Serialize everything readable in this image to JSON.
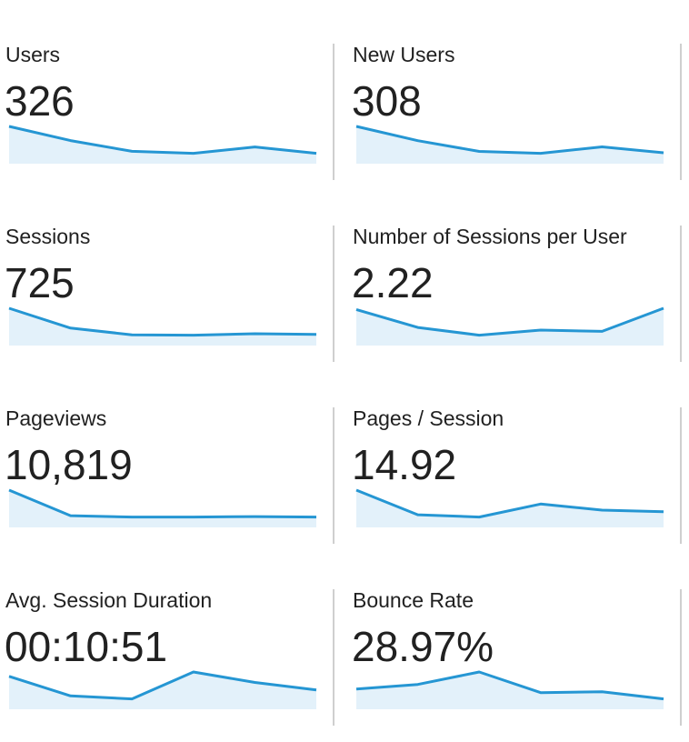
{
  "colors": {
    "line": "#2596d3",
    "fill": "#e3f1fa",
    "divider": "#cfcfcf",
    "text": "#212121"
  },
  "chart_data": [
    {
      "type": "area",
      "title": "Users",
      "value": "326",
      "values": [
        326,
        270,
        228,
        220,
        245,
        220
      ]
    },
    {
      "type": "area",
      "title": "New Users",
      "value": "308",
      "values": [
        308,
        255,
        215,
        208,
        232,
        210
      ]
    },
    {
      "type": "area",
      "title": "Sessions",
      "value": "725",
      "values": [
        725,
        460,
        370,
        365,
        385,
        375
      ]
    },
    {
      "type": "area",
      "title": "Number of Sessions per User",
      "value": "2.22",
      "values": [
        2.22,
        2.08,
        2.02,
        2.06,
        2.05,
        2.23
      ]
    },
    {
      "type": "area",
      "title": "Pageviews",
      "value": "10,819",
      "values": [
        10819,
        5000,
        4700,
        4700,
        4800,
        4700
      ]
    },
    {
      "type": "area",
      "title": "Pages / Session",
      "value": "14.92",
      "values": [
        14.92,
        11.7,
        11.4,
        13.1,
        12.3,
        12.1
      ]
    },
    {
      "type": "area",
      "title": "Avg. Session Duration",
      "value": "00:10:51",
      "values": [
        651,
        520,
        500,
        680,
        610,
        560
      ]
    },
    {
      "type": "area",
      "title": "Bounce Rate",
      "value": "28.97%",
      "values": [
        27.3,
        28.7,
        32.5,
        26.2,
        26.5,
        24.3
      ]
    }
  ]
}
